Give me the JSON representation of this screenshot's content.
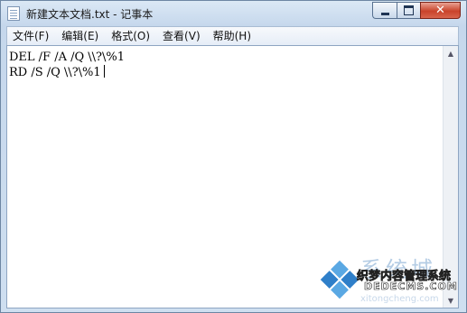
{
  "window": {
    "title": "新建文本文档.txt - 记事本",
    "close_glyph": "✕"
  },
  "menubar": {
    "items": [
      "文件(F)",
      "编辑(E)",
      "格式(O)",
      "查看(V)",
      "帮助(H)"
    ]
  },
  "editor": {
    "lines": [
      "DEL /F /A /Q \\\\?\\%1",
      "RD /S /Q \\\\?\\%1"
    ]
  },
  "scrollbar": {
    "up_glyph": "▲",
    "down_glyph": "▼"
  },
  "watermark": {
    "big_text": "系统城",
    "site_name": "织梦内容管理系统",
    "domain": "DEDECMS.COM",
    "url": "xitongcheng.com",
    "colors": {
      "blue": "#2f7fc9",
      "light_blue": "#5aa8e3"
    }
  },
  "colors": {
    "frame": "#cfdff0",
    "close_button": "#c9432a",
    "editor_background": "#ffffff"
  }
}
